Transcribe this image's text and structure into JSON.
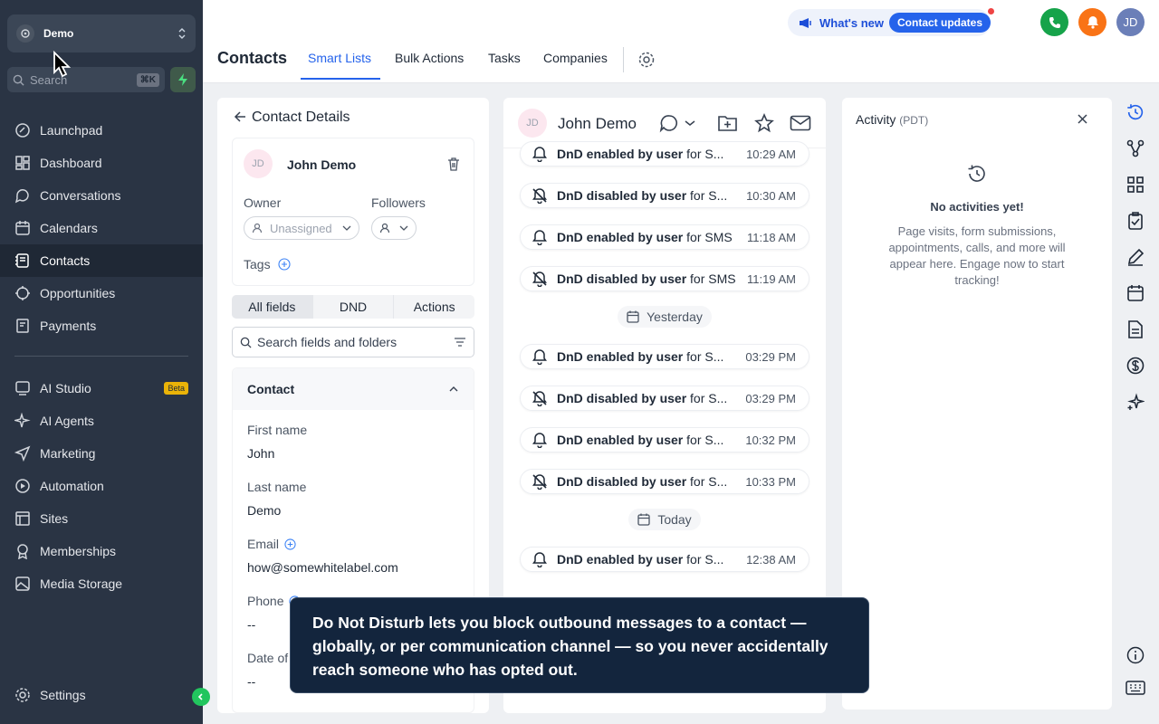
{
  "account": {
    "name": "Demo"
  },
  "search": {
    "placeholder": "Search",
    "shortcut": "⌘K"
  },
  "sidebar": {
    "items": [
      {
        "label": "Launchpad",
        "icon": "rocket-icon"
      },
      {
        "label": "Dashboard",
        "icon": "grid-icon"
      },
      {
        "label": "Conversations",
        "icon": "chat-icon"
      },
      {
        "label": "Calendars",
        "icon": "calendar-icon"
      },
      {
        "label": "Contacts",
        "icon": "contacts-icon",
        "active": true
      },
      {
        "label": "Opportunities",
        "icon": "opportunities-icon"
      },
      {
        "label": "Payments",
        "icon": "payments-icon"
      },
      {
        "label": "AI Studio",
        "icon": "ai-studio-icon",
        "badge": "Beta"
      },
      {
        "label": "AI Agents",
        "icon": "sparkle-icon"
      },
      {
        "label": "Marketing",
        "icon": "send-icon"
      },
      {
        "label": "Automation",
        "icon": "automation-icon"
      },
      {
        "label": "Sites",
        "icon": "sites-icon"
      },
      {
        "label": "Memberships",
        "icon": "membership-icon"
      },
      {
        "label": "Media Storage",
        "icon": "image-icon"
      }
    ],
    "settings_label": "Settings"
  },
  "header": {
    "title": "Contacts",
    "tabs": [
      "Smart Lists",
      "Bulk Actions",
      "Tasks",
      "Companies"
    ],
    "active_tab": "Smart Lists",
    "whats_new": "What's new",
    "contact_updates": "Contact updates",
    "avatar": "JD"
  },
  "contact_details": {
    "title": "Contact Details",
    "initials": "JD",
    "name": "John Demo",
    "owner_label": "Owner",
    "owner_value": "Unassigned",
    "followers_label": "Followers",
    "tags_label": "Tags",
    "tabs": [
      "All fields",
      "DND",
      "Actions"
    ],
    "active_tab": "All fields",
    "field_search_placeholder": "Search fields and folders",
    "section": "Contact",
    "fields": [
      {
        "label": "First name",
        "value": "John"
      },
      {
        "label": "Last name",
        "value": "Demo"
      },
      {
        "label": "Email",
        "value": "how@somewhitelabel.com"
      },
      {
        "label": "Phone",
        "value": "--"
      },
      {
        "label": "Date of",
        "value": "--"
      }
    ]
  },
  "conversation": {
    "initials": "JD",
    "name": "John Demo",
    "items": [
      {
        "bold": "DnD enabled by user",
        "rest": " for S...",
        "time": "10:29 AM",
        "kind": "enabled"
      },
      {
        "bold": "DnD disabled by user",
        "rest": " for S...",
        "time": "10:30 AM",
        "kind": "disabled"
      },
      {
        "bold": "DnD enabled by user",
        "rest": " for SMS",
        "time": "11:18 AM",
        "kind": "enabled"
      },
      {
        "bold": "DnD disabled by user",
        "rest": " for SMS",
        "time": "11:19 AM",
        "kind": "disabled"
      },
      {
        "day": "Yesterday"
      },
      {
        "bold": "DnD enabled by user",
        "rest": " for S...",
        "time": "03:29 PM",
        "kind": "enabled"
      },
      {
        "bold": "DnD disabled by user",
        "rest": " for S...",
        "time": "03:29 PM",
        "kind": "disabled"
      },
      {
        "bold": "DnD enabled by user",
        "rest": " for S...",
        "time": "10:32 PM",
        "kind": "enabled"
      },
      {
        "bold": "DnD disabled by user",
        "rest": " for S...",
        "time": "10:33 PM",
        "kind": "disabled"
      },
      {
        "day": "Today"
      },
      {
        "bold": "DnD enabled by user",
        "rest": " for S...",
        "time": "12:38 AM",
        "kind": "enabled"
      }
    ]
  },
  "activity": {
    "title": "Activity",
    "tz": "(PDT)",
    "empty_title": "No activities yet!",
    "empty_text": "Page visits, form submissions, appointments, calls, and more will appear here. Engage now to start tracking!"
  },
  "tooltip": {
    "text": "Do Not Disturb lets you block outbound messages to a contact — globally, or per communication channel — so you never accidentally reach someone who has opted out."
  },
  "colors": {
    "sidebar": "#2a3444",
    "accent": "#2563eb",
    "phone": "#16a34a",
    "bell": "#f97316",
    "avatar": "#6b7fb8"
  }
}
